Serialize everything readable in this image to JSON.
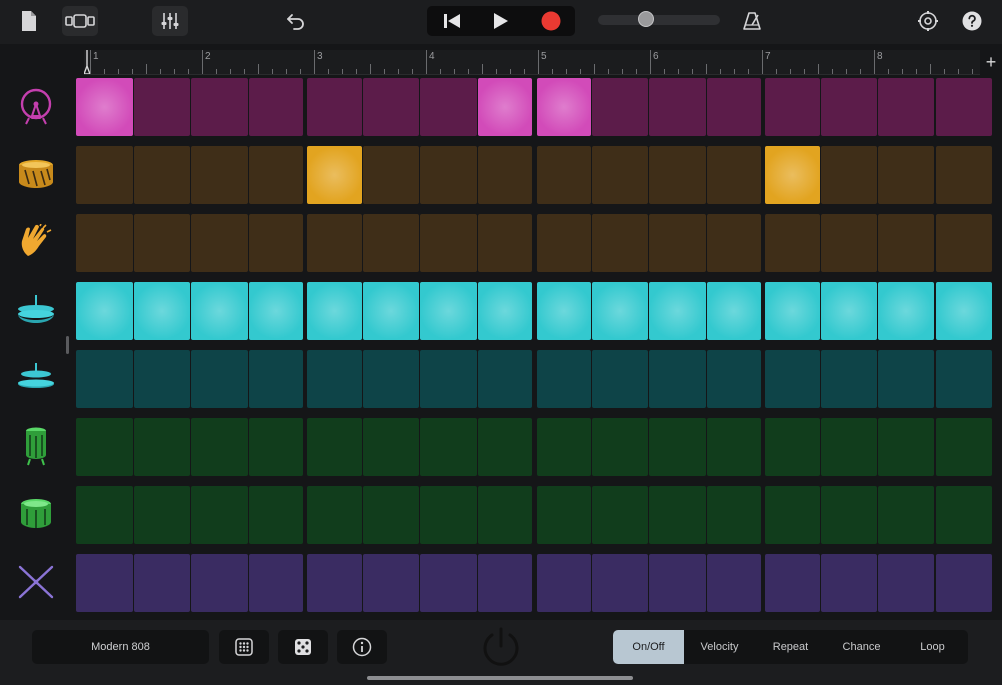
{
  "ruler": {
    "bars": [
      "1",
      "2",
      "3",
      "4",
      "5",
      "6",
      "7",
      "8"
    ],
    "add_label": "+"
  },
  "tracks": [
    {
      "icon": "kick-drum-icon",
      "color": "#c43fae",
      "off": "#5c1c4a",
      "on": "#d24bb9",
      "pattern": [
        1,
        0,
        0,
        0,
        0,
        0,
        0,
        1,
        1,
        0,
        0,
        0,
        0,
        0,
        0,
        0
      ]
    },
    {
      "icon": "snare-drum-icon",
      "color": "#e4a828",
      "off": "#3f2e18",
      "on": "#e2a420",
      "pattern": [
        0,
        0,
        0,
        0,
        1,
        0,
        0,
        0,
        0,
        0,
        0,
        0,
        1,
        0,
        0,
        0
      ]
    },
    {
      "icon": "hand-clap-icon",
      "color": "#f0a830",
      "off": "#3f2e18",
      "on": "#e2a420",
      "pattern": [
        0,
        0,
        0,
        0,
        0,
        0,
        0,
        0,
        0,
        0,
        0,
        0,
        0,
        0,
        0,
        0
      ]
    },
    {
      "icon": "closed-hihat-icon",
      "color": "#3cc7d2",
      "off": "#0e4f54",
      "on": "#33c9cf",
      "pattern": [
        1,
        1,
        1,
        1,
        1,
        1,
        1,
        1,
        1,
        1,
        1,
        1,
        1,
        1,
        1,
        1
      ]
    },
    {
      "icon": "open-hihat-icon",
      "color": "#3cc7d2",
      "off": "#0e4448",
      "on": "#33c9cf",
      "pattern": [
        0,
        0,
        0,
        0,
        0,
        0,
        0,
        0,
        0,
        0,
        0,
        0,
        0,
        0,
        0,
        0
      ]
    },
    {
      "icon": "high-tom-icon",
      "color": "#3fc24c",
      "off": "#113d1c",
      "on": "#3fc24c",
      "pattern": [
        0,
        0,
        0,
        0,
        0,
        0,
        0,
        0,
        0,
        0,
        0,
        0,
        0,
        0,
        0,
        0
      ]
    },
    {
      "icon": "low-tom-icon",
      "color": "#3fc24c",
      "off": "#113d1c",
      "on": "#3fc24c",
      "pattern": [
        0,
        0,
        0,
        0,
        0,
        0,
        0,
        0,
        0,
        0,
        0,
        0,
        0,
        0,
        0,
        0
      ]
    },
    {
      "icon": "drumsticks-icon",
      "color": "#8b74d6",
      "off": "#3a2c62",
      "on": "#8b74d6",
      "pattern": [
        0,
        0,
        0,
        0,
        0,
        0,
        0,
        0,
        0,
        0,
        0,
        0,
        0,
        0,
        0,
        0
      ]
    }
  ],
  "bottom": {
    "kit_name": "Modern 808",
    "modes": [
      {
        "label": "On/Off",
        "active": true
      },
      {
        "label": "Velocity",
        "active": false
      },
      {
        "label": "Repeat",
        "active": false
      },
      {
        "label": "Chance",
        "active": false
      },
      {
        "label": "Loop",
        "active": false
      }
    ]
  },
  "accent": {
    "record": "#ea3a32",
    "active_mode": "#b8c7d2"
  }
}
